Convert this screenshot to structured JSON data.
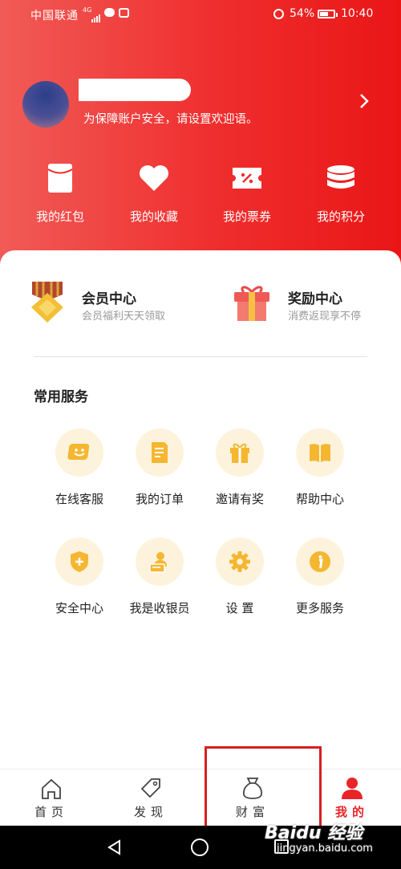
{
  "status_bar": {
    "carrier": "中国联通",
    "network": "4G",
    "battery": "54%",
    "battery_level": 0.54,
    "time": "10:40"
  },
  "profile": {
    "greeting_hint": "为保障账户安全，请设置欢迎语。"
  },
  "quick_actions": [
    {
      "label": "我的红包",
      "icon": "red-envelope-icon"
    },
    {
      "label": "我的收藏",
      "icon": "heart-icon"
    },
    {
      "label": "我的票券",
      "icon": "coupon-icon"
    },
    {
      "label": "我的积分",
      "icon": "coin-stack-icon"
    }
  ],
  "centers": {
    "member": {
      "title": "会员中心",
      "subtitle": "会员福利天天领取"
    },
    "reward": {
      "title": "奖励中心",
      "subtitle": "消费返现享不停"
    }
  },
  "services": {
    "heading": "常用服务",
    "items": [
      {
        "label": "在线客服",
        "icon": "chat-icon"
      },
      {
        "label": "我的订单",
        "icon": "order-icon"
      },
      {
        "label": "邀请有奖",
        "icon": "gift-icon"
      },
      {
        "label": "帮助中心",
        "icon": "book-icon"
      },
      {
        "label": "安全中心",
        "icon": "shield-icon"
      },
      {
        "label": "我是收银员",
        "icon": "cashier-icon"
      },
      {
        "label": "设 置",
        "icon": "gear-icon"
      },
      {
        "label": "更多服务",
        "icon": "info-icon"
      }
    ]
  },
  "tabs": [
    {
      "label": "首页",
      "icon": "home-icon"
    },
    {
      "label": "发现",
      "icon": "tag-icon"
    },
    {
      "label": "财富",
      "icon": "money-bag-icon"
    },
    {
      "label": "我的",
      "icon": "person-icon",
      "active": true
    }
  ],
  "watermark": {
    "brand": "Baidu 经验",
    "url": "jingyan.baidu.com"
  },
  "colors": {
    "primary_red": "#ef2d2d",
    "icon_gold": "#f5b731",
    "icon_bg": "#fdf3dc",
    "highlight": "#d81e22"
  }
}
